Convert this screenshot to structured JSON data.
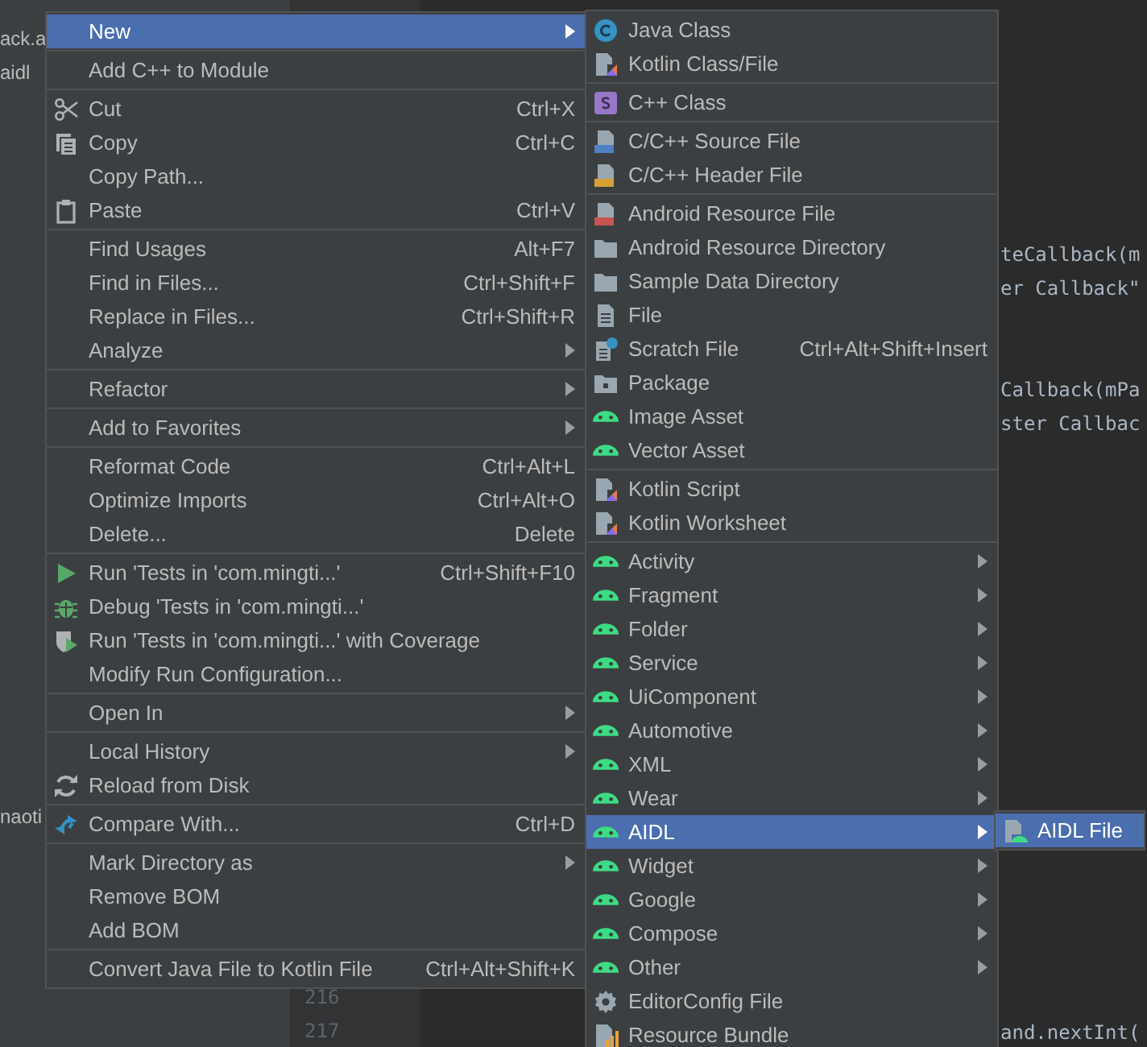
{
  "project": {
    "groups": [
      [
        "ack.a",
        "aidl"
      ],
      [
        "naoti"
      ]
    ]
  },
  "editor": {
    "line_numbers": [
      "216",
      "217"
    ],
    "code_groups": [
      [
        "teCallback(m",
        "er Callback\""
      ],
      [
        "Callback(mPa",
        "ster Callbac"
      ],
      [
        "and.nextInt("
      ]
    ]
  },
  "main_menu": {
    "items": [
      {
        "kind": "plain",
        "label": "New",
        "submenu": true,
        "selected": true
      },
      {
        "kind": "separator"
      },
      {
        "kind": "plain",
        "label": "Add C++ to Module",
        "submenu": false,
        "selected": false
      },
      {
        "kind": "separator"
      },
      {
        "kind": "cut",
        "label": "Cut",
        "shortcut": "Ctrl+X",
        "submenu": false,
        "selected": false
      },
      {
        "kind": "copy",
        "label": "Copy",
        "shortcut": "Ctrl+C",
        "submenu": false,
        "selected": false
      },
      {
        "kind": "plain",
        "label": "Copy Path...",
        "submenu": false,
        "selected": false
      },
      {
        "kind": "paste",
        "label": "Paste",
        "shortcut": "Ctrl+V",
        "submenu": false,
        "selected": false
      },
      {
        "kind": "separator"
      },
      {
        "kind": "plain",
        "label": "Find Usages",
        "shortcut": "Alt+F7",
        "submenu": false,
        "selected": false
      },
      {
        "kind": "plain",
        "label": "Find in Files...",
        "shortcut": "Ctrl+Shift+F",
        "submenu": false,
        "selected": false
      },
      {
        "kind": "plain",
        "label": "Replace in Files...",
        "shortcut": "Ctrl+Shift+R",
        "submenu": false,
        "selected": false
      },
      {
        "kind": "plain",
        "label": "Analyze",
        "submenu": true,
        "selected": false
      },
      {
        "kind": "separator"
      },
      {
        "kind": "plain",
        "label": "Refactor",
        "submenu": true,
        "selected": false
      },
      {
        "kind": "separator"
      },
      {
        "kind": "plain",
        "label": "Add to Favorites",
        "submenu": true,
        "selected": false
      },
      {
        "kind": "separator"
      },
      {
        "kind": "plain",
        "label": "Reformat Code",
        "shortcut": "Ctrl+Alt+L",
        "submenu": false,
        "selected": false
      },
      {
        "kind": "plain",
        "label": "Optimize Imports",
        "shortcut": "Ctrl+Alt+O",
        "submenu": false,
        "selected": false
      },
      {
        "kind": "plain",
        "label": "Delete...",
        "shortcut": "Delete",
        "submenu": false,
        "selected": false
      },
      {
        "kind": "separator"
      },
      {
        "kind": "run",
        "label": "Run 'Tests in 'com.mingti...'",
        "shortcut": "Ctrl+Shift+F10",
        "submenu": false,
        "selected": false
      },
      {
        "kind": "debug",
        "label": "Debug 'Tests in 'com.mingti...'",
        "submenu": false,
        "selected": false
      },
      {
        "kind": "coverage",
        "label": "Run 'Tests in 'com.mingti...' with Coverage",
        "submenu": false,
        "selected": false
      },
      {
        "kind": "plain",
        "label": "Modify Run Configuration...",
        "submenu": false,
        "selected": false
      },
      {
        "kind": "separator"
      },
      {
        "kind": "plain",
        "label": "Open In",
        "submenu": true,
        "selected": false
      },
      {
        "kind": "separator"
      },
      {
        "kind": "plain",
        "label": "Local History",
        "submenu": true,
        "selected": false
      },
      {
        "kind": "reload",
        "label": "Reload from Disk",
        "submenu": false,
        "selected": false
      },
      {
        "kind": "separator"
      },
      {
        "kind": "compare",
        "label": "Compare With...",
        "shortcut": "Ctrl+D",
        "submenu": false,
        "selected": false
      },
      {
        "kind": "separator"
      },
      {
        "kind": "plain",
        "label": "Mark Directory as",
        "submenu": true,
        "selected": false
      },
      {
        "kind": "plain",
        "label": "Remove BOM",
        "submenu": false,
        "selected": false
      },
      {
        "kind": "plain",
        "label": "Add BOM",
        "submenu": false,
        "selected": false
      },
      {
        "kind": "separator"
      },
      {
        "kind": "plain",
        "label": "Convert Java File to Kotlin File",
        "shortcut": "Ctrl+Alt+Shift+K",
        "submenu": false,
        "selected": false
      }
    ]
  },
  "new_submenu": {
    "items": [
      {
        "kind": "java",
        "label": "Java Class",
        "submenu": false,
        "selected": false
      },
      {
        "kind": "kotlin",
        "label": "Kotlin Class/File",
        "submenu": false,
        "selected": false
      },
      {
        "kind": "separator"
      },
      {
        "kind": "cppclass",
        "label": "C++ Class",
        "submenu": false,
        "selected": false
      },
      {
        "kind": "separator"
      },
      {
        "kind": "source",
        "label": "C/C++ Source File",
        "submenu": false,
        "selected": false
      },
      {
        "kind": "header",
        "label": "C/C++ Header File",
        "submenu": false,
        "selected": false
      },
      {
        "kind": "separator"
      },
      {
        "kind": "resource",
        "label": "Android Resource File",
        "submenu": false,
        "selected": false
      },
      {
        "kind": "folder",
        "label": "Android Resource Directory",
        "submenu": false,
        "selected": false
      },
      {
        "kind": "folder",
        "label": "Sample Data Directory",
        "submenu": false,
        "selected": false
      },
      {
        "kind": "file",
        "label": "File",
        "submenu": false,
        "selected": false
      },
      {
        "kind": "scratch",
        "label": "Scratch File",
        "shortcut": "Ctrl+Alt+Shift+Insert",
        "submenu": false,
        "selected": false
      },
      {
        "kind": "package",
        "label": "Package",
        "submenu": false,
        "selected": false
      },
      {
        "kind": "android",
        "label": "Image Asset",
        "submenu": false,
        "selected": false
      },
      {
        "kind": "android",
        "label": "Vector Asset",
        "submenu": false,
        "selected": false
      },
      {
        "kind": "separator"
      },
      {
        "kind": "kotlin",
        "label": "Kotlin Script",
        "submenu": false,
        "selected": false
      },
      {
        "kind": "kotlin",
        "label": "Kotlin Worksheet",
        "submenu": false,
        "selected": false
      },
      {
        "kind": "separator"
      },
      {
        "kind": "android",
        "label": "Activity",
        "submenu": true,
        "selected": false
      },
      {
        "kind": "android",
        "label": "Fragment",
        "submenu": true,
        "selected": false
      },
      {
        "kind": "android",
        "label": "Folder",
        "submenu": true,
        "selected": false
      },
      {
        "kind": "android",
        "label": "Service",
        "submenu": true,
        "selected": false
      },
      {
        "kind": "android",
        "label": "UiComponent",
        "submenu": true,
        "selected": false
      },
      {
        "kind": "android",
        "label": "Automotive",
        "submenu": true,
        "selected": false
      },
      {
        "kind": "android",
        "label": "XML",
        "submenu": true,
        "selected": false
      },
      {
        "kind": "android",
        "label": "Wear",
        "submenu": true,
        "selected": false
      },
      {
        "kind": "android",
        "label": "AIDL",
        "submenu": true,
        "selected": true
      },
      {
        "kind": "android",
        "label": "Widget",
        "submenu": true,
        "selected": false
      },
      {
        "kind": "android",
        "label": "Google",
        "submenu": true,
        "selected": false
      },
      {
        "kind": "android",
        "label": "Compose",
        "submenu": true,
        "selected": false
      },
      {
        "kind": "android",
        "label": "Other",
        "submenu": true,
        "selected": false
      },
      {
        "kind": "config",
        "label": "EditorConfig File",
        "submenu": false,
        "selected": false
      },
      {
        "kind": "bundle",
        "label": "Resource Bundle",
        "submenu": false,
        "selected": false
      }
    ]
  },
  "aidl_submenu": {
    "items": [
      {
        "kind": "aidl",
        "label": "AIDL File",
        "submenu": false,
        "selected": true
      }
    ]
  }
}
